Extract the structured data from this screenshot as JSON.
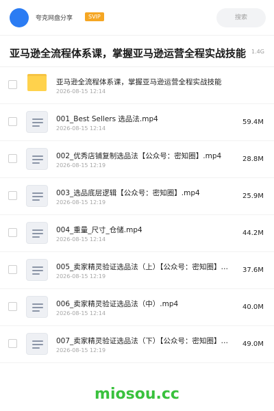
{
  "header": {
    "share_name": "夸克网盘分享",
    "badge": "SVIP",
    "search_placeholder": "搜索"
  },
  "folder": {
    "title": "亚马逊全流程体系课，掌握亚马逊运营全程实战技能",
    "total_size": "1.4G"
  },
  "files": [
    {
      "name": "亚马逊全流程体系课，掌握亚马逊运营全程实战技能",
      "date": "2026-08-15 12:14",
      "size": "",
      "type": "folder"
    },
    {
      "name": "001_Best Sellers 选品法.mp4",
      "date": "2026-08-15 12:14",
      "size": "59.4M",
      "type": "video"
    },
    {
      "name": "002_优秀店铺复制选品法【公众号：密知圈】.mp4",
      "date": "2026-08-15 12:19",
      "size": "28.8M",
      "type": "video"
    },
    {
      "name": "003_选品底层逻辑【公众号：密知圈】.mp4",
      "date": "2026-08-15 12:19",
      "size": "25.9M",
      "type": "video"
    },
    {
      "name": "004_重量_尺寸_仓储.mp4",
      "date": "2026-08-15 12:14",
      "size": "44.2M",
      "type": "video"
    },
    {
      "name": "005_卖家精灵验证选品法（上）【公众号：密知圈】…",
      "date": "2026-08-15 12:19",
      "size": "37.6M",
      "type": "video"
    },
    {
      "name": "006_卖家精灵验证选品法（中）.mp4",
      "date": "2026-08-15 12:14",
      "size": "40.0M",
      "type": "video"
    },
    {
      "name": "007_卖家精灵验证选品法（下）【公众号：密知圈】…",
      "date": "2026-08-15 12:19",
      "size": "49.0M",
      "type": "video"
    }
  ],
  "watermark": "miosou.cc",
  "colors": {
    "accent": "#2b7cf3",
    "badge": "#f5a623",
    "watermark": "#39c13d",
    "folder": "#ffd24c"
  }
}
